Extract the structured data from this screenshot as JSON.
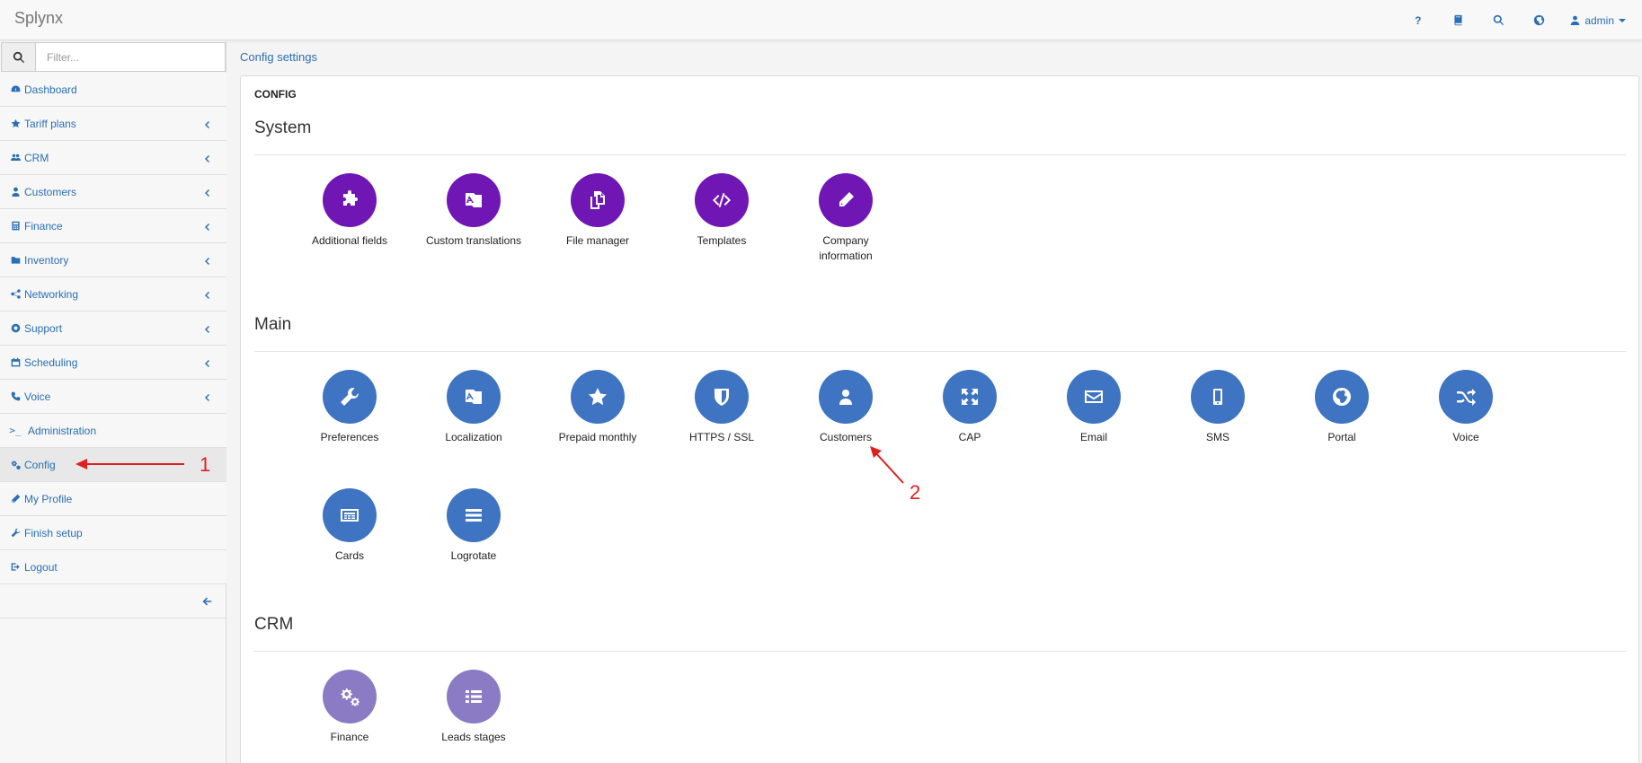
{
  "app": {
    "brand": "Splynx"
  },
  "topnav": {
    "user_label": "admin"
  },
  "filter": {
    "placeholder": "Filter..."
  },
  "sidebar": {
    "items": [
      {
        "label": "Dashboard",
        "icon": "dashboard-icon"
      },
      {
        "label": "Tariff plans",
        "icon": "star-icon"
      },
      {
        "label": "CRM",
        "icon": "users-icon"
      },
      {
        "label": "Customers",
        "icon": "user-icon"
      },
      {
        "label": "Finance",
        "icon": "calculator-icon"
      },
      {
        "label": "Inventory",
        "icon": "folder-icon"
      },
      {
        "label": "Networking",
        "icon": "network-icon"
      },
      {
        "label": "Support",
        "icon": "lifebuoy-icon"
      },
      {
        "label": "Scheduling",
        "icon": "calendar-icon"
      },
      {
        "label": "Voice",
        "icon": "phone-icon"
      },
      {
        "label": "Administration",
        "icon": "terminal-icon"
      },
      {
        "label": "Config",
        "icon": "cogs-icon"
      },
      {
        "label": "My Profile",
        "icon": "pencil-icon"
      },
      {
        "label": "Finish setup",
        "icon": "wrench-icon"
      },
      {
        "label": "Logout",
        "icon": "logout-icon"
      }
    ]
  },
  "breadcrumb": {
    "label": "Config settings"
  },
  "panel": {
    "title": "CONFIG",
    "sections": {
      "system": {
        "title": "System",
        "color": "#6f16b5",
        "tiles": [
          {
            "label": "Additional fields",
            "icon": "puzzle-icon"
          },
          {
            "label": "Custom translations",
            "icon": "translate-icon"
          },
          {
            "label": "File manager",
            "icon": "files-icon"
          },
          {
            "label": "Templates",
            "icon": "code-icon"
          },
          {
            "label": "Company information",
            "icon": "pencil-icon"
          }
        ]
      },
      "main": {
        "title": "Main",
        "color": "#3e74c2",
        "tiles": [
          {
            "label": "Preferences",
            "icon": "wrench-icon"
          },
          {
            "label": "Localization",
            "icon": "translate-icon"
          },
          {
            "label": "Prepaid monthly",
            "icon": "star-icon"
          },
          {
            "label": "HTTPS / SSL",
            "icon": "shield-icon"
          },
          {
            "label": "Customers",
            "icon": "user-icon"
          },
          {
            "label": "CAP",
            "icon": "expand-icon"
          },
          {
            "label": "Email",
            "icon": "envelope-icon"
          },
          {
            "label": "SMS",
            "icon": "mobile-icon"
          },
          {
            "label": "Portal",
            "icon": "globe-icon"
          },
          {
            "label": "Voice",
            "icon": "shuffle-icon"
          },
          {
            "label": "Cards",
            "icon": "card-icon"
          },
          {
            "label": "Logrotate",
            "icon": "list-icon"
          }
        ]
      },
      "crm": {
        "title": "CRM",
        "color": "#8a7bc4",
        "tiles": [
          {
            "label": "Finance",
            "icon": "cogs-icon"
          },
          {
            "label": "Leads stages",
            "icon": "list-icon"
          }
        ]
      }
    }
  },
  "annotations": {
    "marker_1": "1",
    "marker_2": "2",
    "color": "#e02020"
  }
}
